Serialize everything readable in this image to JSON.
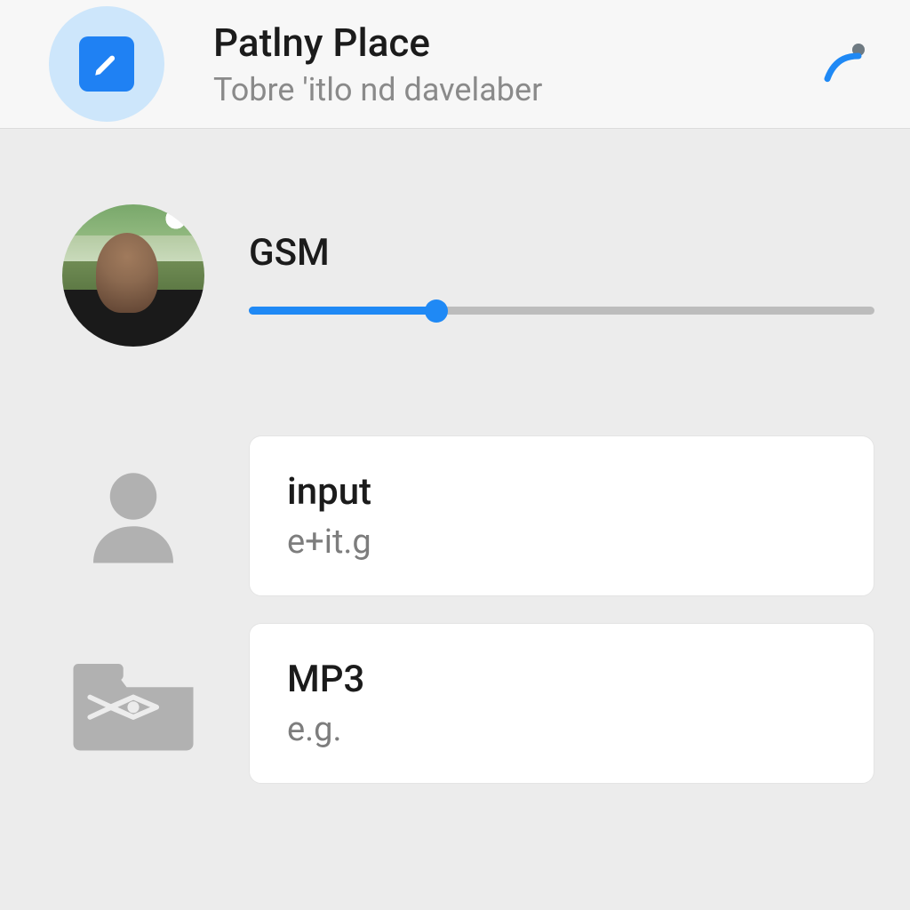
{
  "header": {
    "title": "Patlny Place",
    "subtitle": "Tobre 'itlo nd davelaber"
  },
  "profile": {
    "label": "GSM",
    "slider_percent": 30
  },
  "cards": [
    {
      "title": "input",
      "subtitle": "e+it.g"
    },
    {
      "title": "MP3",
      "subtitle": "e.g."
    }
  ],
  "colors": {
    "accent": "#1f89f5"
  }
}
